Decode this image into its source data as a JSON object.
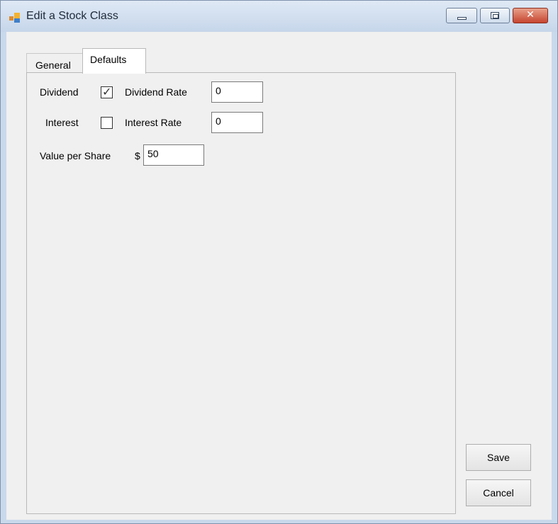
{
  "window": {
    "title": "Edit a Stock Class",
    "close_glyph": "✕"
  },
  "tabs": {
    "general_label": "General",
    "defaults_label": "Defaults"
  },
  "defaults": {
    "dividend_label": "Dividend",
    "dividend_checked": true,
    "dividend_check_glyph": "✓",
    "dividend_rate_label": "Dividend Rate",
    "dividend_rate_value": "0",
    "interest_label": "Interest",
    "interest_checked": false,
    "interest_rate_label": "Interest Rate",
    "interest_rate_value": "0",
    "value_per_share_label": "Value per Share",
    "currency_symbol": "$",
    "value_per_share_value": "50"
  },
  "buttons": {
    "save_label": "Save",
    "cancel_label": "Cancel"
  }
}
